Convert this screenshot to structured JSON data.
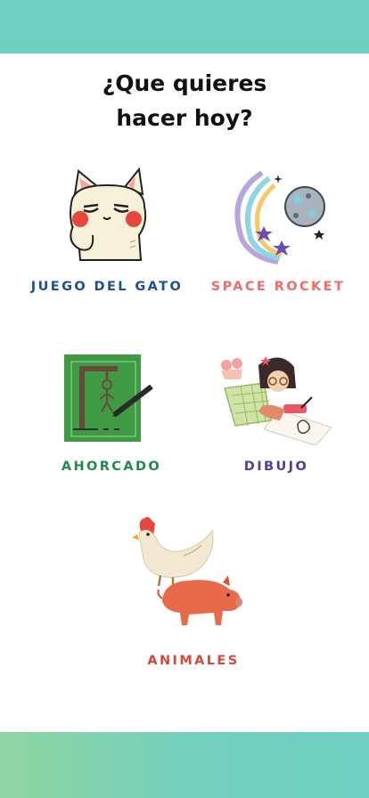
{
  "header": {
    "title_line1": "¿Que quieres",
    "title_line2": "hacer hoy?"
  },
  "activities": [
    {
      "label": "JUEGO DEL GATO",
      "icon": "cat-icon",
      "color": "#1b4f9c"
    },
    {
      "label": "SPACE ROCKET",
      "icon": "planet-icon",
      "color": "#f26a6a"
    },
    {
      "label": "AHORCADO",
      "icon": "hangman-icon",
      "color": "#1f8a4c"
    },
    {
      "label": "DIBUJO",
      "icon": "drawing-girl-icon",
      "color": "#5b3a93"
    },
    {
      "label": "ANIMALES",
      "icon": "chicken-pig-icon",
      "color": "#d24a3d"
    }
  ],
  "colors": {
    "top_band": "#6ccfbf",
    "bottom_band": "#75cfbd"
  }
}
